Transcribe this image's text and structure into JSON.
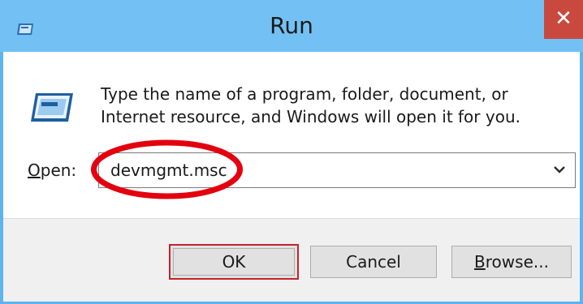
{
  "window": {
    "title": "Run",
    "close_glyph": "✕"
  },
  "icons": {
    "title_icon": "run-icon",
    "dialog_icon": "run-icon",
    "dropdown": "chevron-down-icon"
  },
  "content": {
    "description": "Type the name of a program, folder, document, or Internet resource, and Windows will open it for you.",
    "open_label_accel": "O",
    "open_label_rest": "pen:",
    "open_value": "devmgmt.msc"
  },
  "buttons": {
    "ok_label": "OK",
    "cancel_label": "Cancel",
    "browse_accel": "B",
    "browse_rest": "rowse..."
  },
  "colors": {
    "title_bar": "#73c1f4",
    "close_button": "#c9493e",
    "highlight_ellipse": "#e3000f",
    "ok_button_border": "#c0252e"
  }
}
